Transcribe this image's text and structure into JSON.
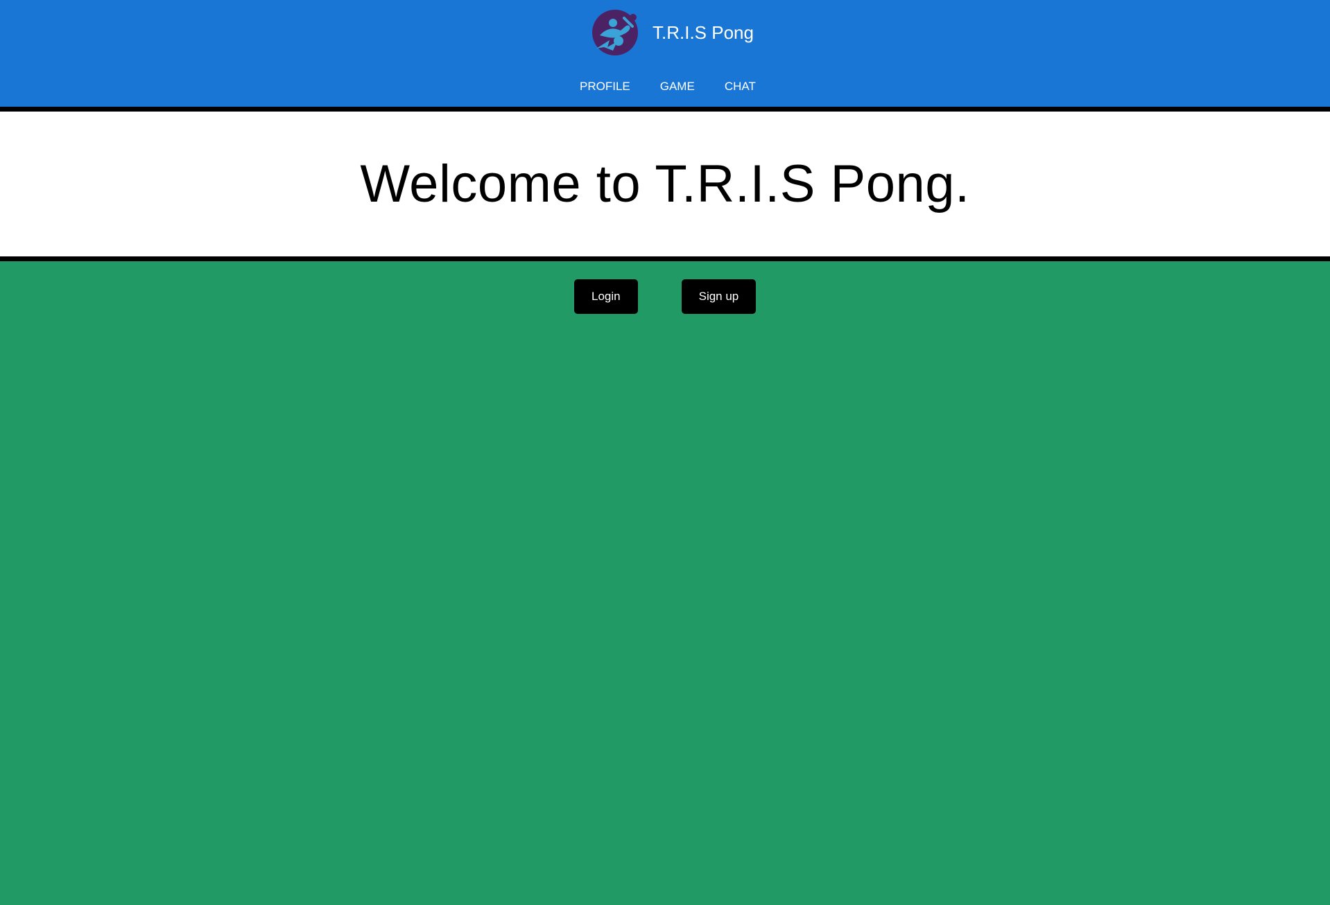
{
  "header": {
    "title": "T.R.I.S Pong",
    "logo": {
      "icon": "ping-pong-player-icon",
      "colors": [
        "#4b2364",
        "#3aa4d8"
      ]
    },
    "nav": [
      {
        "label": "PROFILE"
      },
      {
        "label": "GAME"
      },
      {
        "label": "CHAT"
      }
    ]
  },
  "hero": {
    "title": "Welcome to T.R.I.S Pong."
  },
  "actions": {
    "login_label": "Login",
    "signup_label": "Sign up"
  },
  "theme": {
    "header_bg": "#1a76d5",
    "page_bg": "#229a66",
    "hero_bg": "#ffffff",
    "button_bg": "#000000"
  }
}
